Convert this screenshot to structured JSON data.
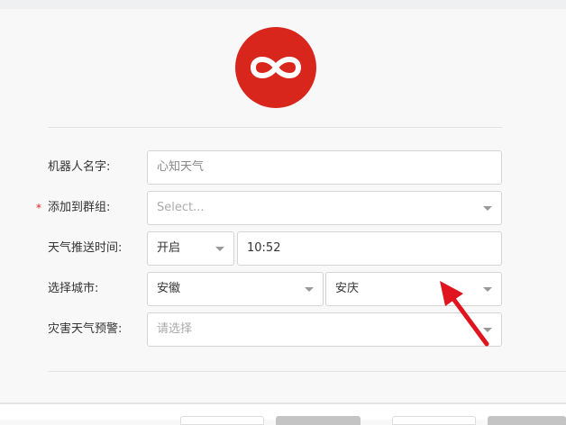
{
  "form": {
    "robot_name": {
      "label": "机器人名字:",
      "value": "心知天气"
    },
    "group": {
      "label": "添加到群组:",
      "required_mark": "*",
      "placeholder": "Select..."
    },
    "push_time": {
      "label": "天气推送时间:",
      "toggle": "开启",
      "time": "10:52"
    },
    "city": {
      "label": "选择城市:",
      "province": "安徽",
      "city": "安庆"
    },
    "alert": {
      "label": "灾害天气预警:",
      "placeholder": "请选择"
    }
  },
  "colors": {
    "brand": "#d9261c",
    "annotation_arrow": "#e0141e"
  }
}
